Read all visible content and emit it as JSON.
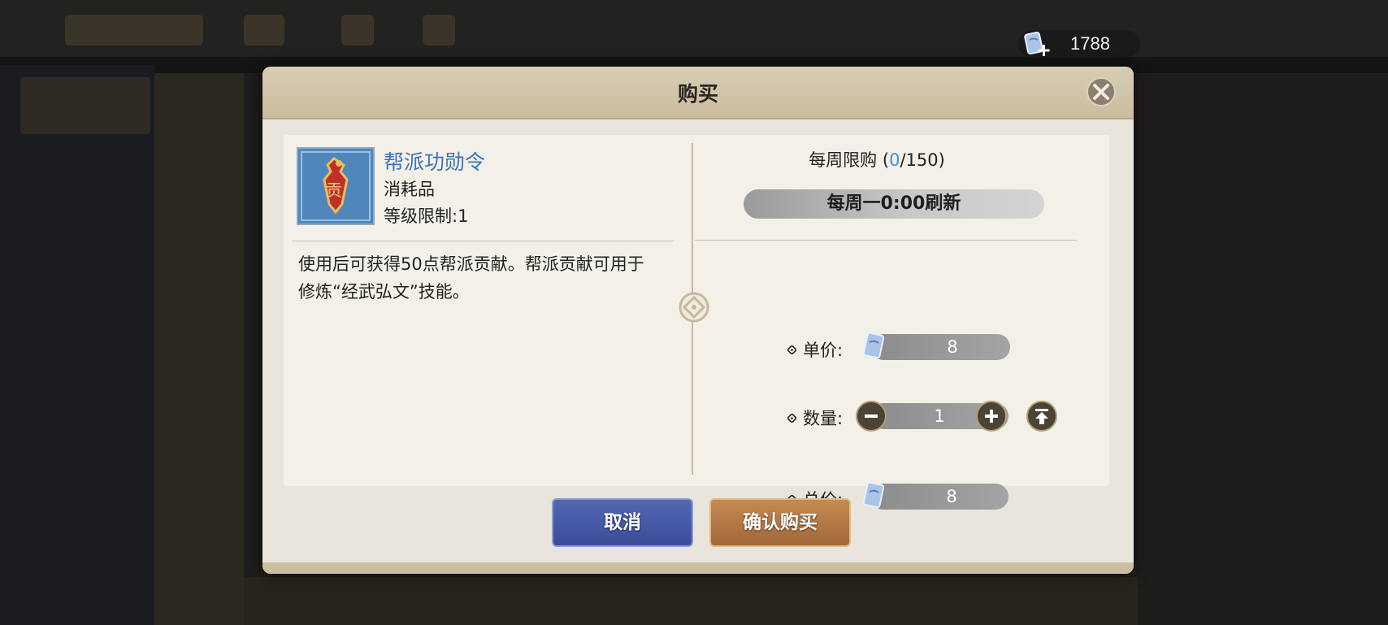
{
  "currency": {
    "icon": "scroll-plus-icon",
    "amount": "1788"
  },
  "dialog": {
    "title": "购买",
    "close_icon": "close-icon",
    "item": {
      "name": "帮派功勋令",
      "type": "消耗品",
      "level_limit": "等级限制:1",
      "description": "使用后可获得50点帮派贡献。帮派贡献可用于修炼“经武弘文”技能。",
      "icon_char": "贡"
    },
    "purchase": {
      "weekly_label": "每周限购 (",
      "weekly_current": "0",
      "weekly_limit": "/150)",
      "refresh_text": "每周一0:00刷新",
      "unit_price_label": "单价:",
      "unit_price": "8",
      "quantity_label": "数量:",
      "quantity": "1",
      "total_label": "总价:",
      "total": "8"
    },
    "buttons": {
      "cancel": "取消",
      "confirm": "确认购买"
    }
  },
  "colors": {
    "accent_blue": "#3a8ee0",
    "item_name": "#3c74b8",
    "cancel": "#4658a6",
    "confirm": "#b37844"
  }
}
